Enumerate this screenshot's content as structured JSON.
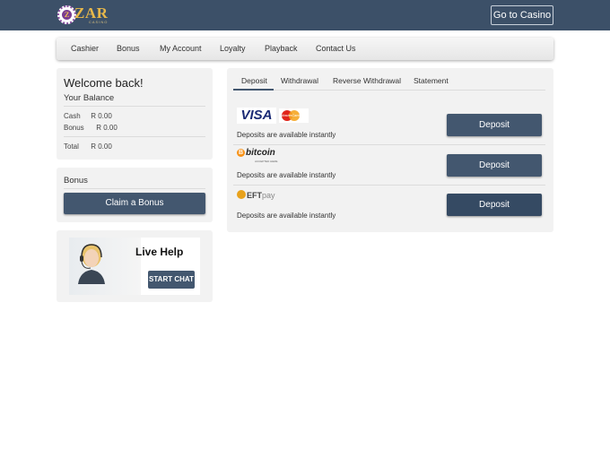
{
  "header": {
    "logo_text": "ZAR",
    "logo_sub": "CASINO",
    "go_casino": "Go to Casino"
  },
  "nav": {
    "items": [
      "Cashier",
      "Bonus",
      "My Account",
      "Loyalty",
      "Playback",
      "Contact Us"
    ]
  },
  "balance": {
    "welcome": "Welcome back!",
    "title": "Your Balance",
    "cash_label": "Cash",
    "cash_value": "R 0.00",
    "bonus_label": "Bonus",
    "bonus_value": "R 0.00",
    "total_label": "Total",
    "total_value": "R 0.00"
  },
  "bonus": {
    "title": "Bonus",
    "claim_label": "Claim a Bonus"
  },
  "live_help": {
    "title": "Live Help",
    "button": "START CHAT"
  },
  "tabs": {
    "items": [
      "Deposit",
      "Withdrawal",
      "Reverse Withdrawal",
      "Statement"
    ],
    "active": "Deposit"
  },
  "methods": [
    {
      "name": "visa-mastercard",
      "logo_text": "VISA",
      "logo_text2": "MasterCard",
      "note": "Deposits are available instantly",
      "button": "Deposit"
    },
    {
      "name": "bitcoin",
      "logo_text": "bitcoin",
      "logo_sub": "ACCEPTED HERE",
      "note": "Deposits are available instantly",
      "button": "Deposit"
    },
    {
      "name": "eftpay",
      "logo_text": "EFT",
      "logo_text2": "pay",
      "note": "Deposits are available instantly",
      "button": "Deposit"
    }
  ],
  "colors": {
    "header_bg": "#3c5068",
    "button_bg": "#43576f",
    "panel_bg": "#f2f2f2",
    "logo_gold": "#e8b84a"
  }
}
